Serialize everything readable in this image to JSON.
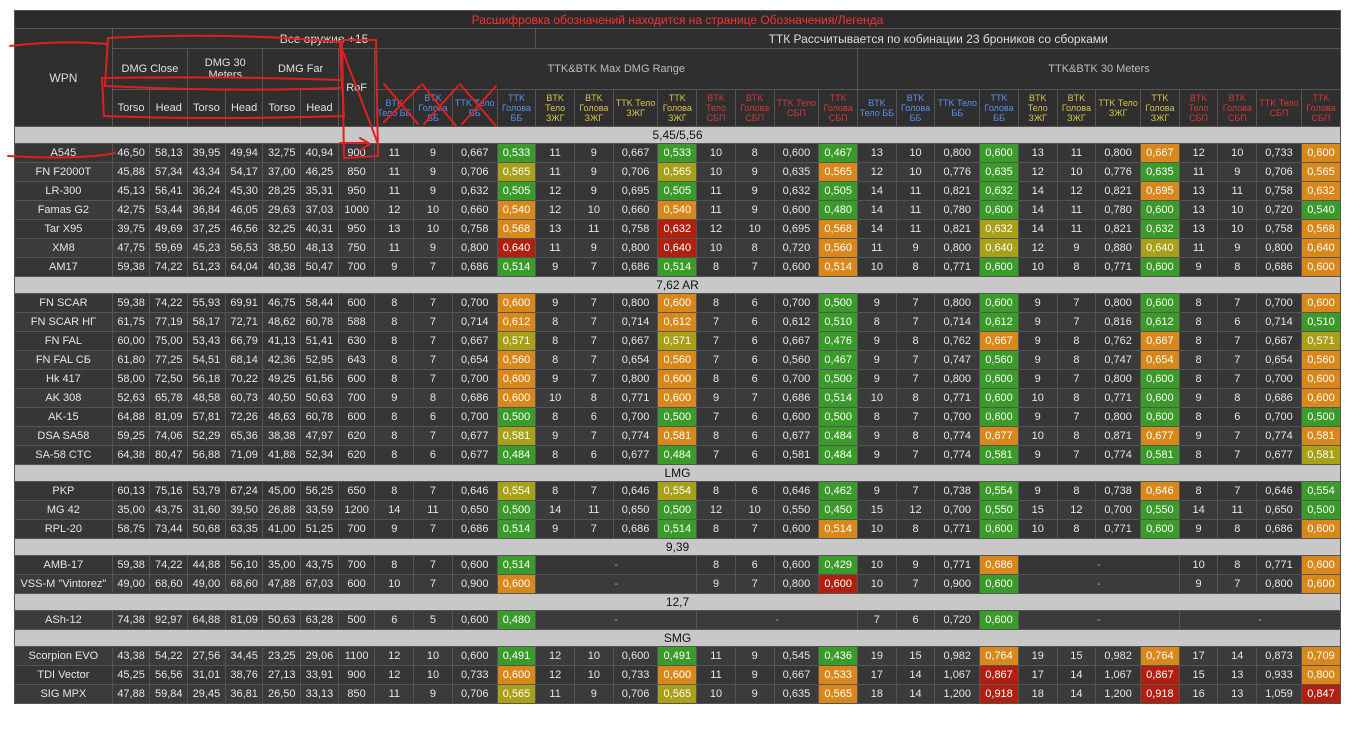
{
  "banner": "Расшифровка обозначений находится на странице Обозначения/Легенда",
  "groups": {
    "all_weapons": "Все оружие +15",
    "ttk_note": "ТТК Рассчитывается по кобинации 23 броников со сборками"
  },
  "headers": {
    "wpn": "WPN",
    "dmg_close": "DMG Close",
    "dmg_30": "DMG 30 Meters",
    "dmg_far": "DMG Far",
    "rof": "RoF",
    "ttk_range": "TTK&BTK Max DMG Range",
    "ttk_30": "TTK&BTK 30 Meters",
    "torso": "Torso",
    "head": "Head"
  },
  "sub_cols": [
    {
      "t": "BTK Тело ББ",
      "c": "blue"
    },
    {
      "t": "BTK Голова ББ",
      "c": "blue"
    },
    {
      "t": "TTK Тело ББ",
      "c": "blue"
    },
    {
      "t": "TTK Голова ББ",
      "c": "blue"
    },
    {
      "t": "BTK Тело ЗЖГ",
      "c": "yel"
    },
    {
      "t": "BTK Голова ЗЖГ",
      "c": "yel"
    },
    {
      "t": "TTK Тело ЗЖГ",
      "c": "yel"
    },
    {
      "t": "TTK Голова ЗЖГ",
      "c": "yel"
    },
    {
      "t": "BTK Тело СБП",
      "c": "red"
    },
    {
      "t": "BTK Голова СБП",
      "c": "red"
    },
    {
      "t": "TTK Тело СБП",
      "c": "red"
    },
    {
      "t": "TTK Голова СБП",
      "c": "red"
    },
    {
      "t": "BTK Тело ББ",
      "c": "blue"
    },
    {
      "t": "BTK Голова ББ",
      "c": "blue"
    },
    {
      "t": "TTK Тело ББ",
      "c": "blue"
    },
    {
      "t": "TTK Голова ББ",
      "c": "blue"
    },
    {
      "t": "BTK Тело ЗЖГ",
      "c": "yel"
    },
    {
      "t": "BTK Голова ЗЖГ",
      "c": "yel"
    },
    {
      "t": "TTK Тело ЗЖГ",
      "c": "yel"
    },
    {
      "t": "TTK Голова ЗЖГ",
      "c": "yel"
    },
    {
      "t": "BTK Тело СБП",
      "c": "red"
    },
    {
      "t": "BTK Голова СБП",
      "c": "red"
    },
    {
      "t": "TTK Тело СБП",
      "c": "red"
    },
    {
      "t": "TTK Голова СБП",
      "c": "red"
    }
  ],
  "sections": [
    {
      "name": "5,45/5,56",
      "rows": [
        [
          "A545",
          "46,50",
          "58,13",
          "39,95",
          "49,94",
          "32,75",
          "40,94",
          "900",
          "11",
          "9",
          "0,667",
          "0,533:g",
          "11",
          "9",
          "0,667",
          "0,533:g",
          "10",
          "8",
          "0,600",
          "0,467:g",
          "13",
          "10",
          "0,800",
          "0,600:g",
          "13",
          "11",
          "0,800",
          "0,667:o",
          "12",
          "10",
          "0,733",
          "0,600:o"
        ],
        [
          "FN F2000T",
          "45,88",
          "57,34",
          "43,34",
          "54,17",
          "37,00",
          "46,25",
          "850",
          "11",
          "9",
          "0,706",
          "0,565:y",
          "11",
          "9",
          "0,706",
          "0,565:y",
          "10",
          "9",
          "0,635",
          "0,565:o",
          "12",
          "10",
          "0,776",
          "0,635:g",
          "12",
          "10",
          "0,776",
          "0,635:g",
          "11",
          "9",
          "0,706",
          "0,565:o"
        ],
        [
          "LR-300",
          "45,13",
          "56,41",
          "36,24",
          "45,30",
          "28,25",
          "35,31",
          "950",
          "11",
          "9",
          "0,632",
          "0,505:g",
          "12",
          "9",
          "0,695",
          "0,505:g",
          "11",
          "9",
          "0,632",
          "0,505:g",
          "14",
          "11",
          "0,821",
          "0,632:g",
          "14",
          "12",
          "0,821",
          "0,695:o",
          "13",
          "11",
          "0,758",
          "0,632:o"
        ],
        [
          "Famas G2",
          "42,75",
          "53,44",
          "36,84",
          "46,05",
          "29,63",
          "37,03",
          "1000",
          "12",
          "10",
          "0,660",
          "0,540:o",
          "12",
          "10",
          "0,660",
          "0,540:o",
          "11",
          "9",
          "0,600",
          "0,480:g",
          "14",
          "11",
          "0,780",
          "0,600:g",
          "14",
          "11",
          "0,780",
          "0,600:g",
          "13",
          "10",
          "0,720",
          "0,540:g"
        ],
        [
          "Tar X95",
          "39,75",
          "49,69",
          "37,25",
          "46,56",
          "32,25",
          "40,31",
          "950",
          "13",
          "10",
          "0,758",
          "0,568:o",
          "13",
          "11",
          "0,758",
          "0,632:r",
          "12",
          "10",
          "0,695",
          "0,568:o",
          "14",
          "11",
          "0,821",
          "0,632:y",
          "14",
          "11",
          "0,821",
          "0,632:g",
          "13",
          "10",
          "0,758",
          "0,568:o"
        ],
        [
          "XM8",
          "47,75",
          "59,69",
          "45,23",
          "56,53",
          "38,50",
          "48,13",
          "750",
          "11",
          "9",
          "0,800",
          "0,640:r",
          "11",
          "9",
          "0,800",
          "0,640:r",
          "10",
          "8",
          "0,720",
          "0,560:o",
          "11",
          "9",
          "0,800",
          "0,640:y",
          "12",
          "9",
          "0,880",
          "0,640:y",
          "11",
          "9",
          "0,800",
          "0,640:o"
        ],
        [
          "AM17",
          "59,38",
          "74,22",
          "51,23",
          "64,04",
          "40,38",
          "50,47",
          "700",
          "9",
          "7",
          "0,686",
          "0,514:g",
          "9",
          "7",
          "0,686",
          "0,514:g",
          "8",
          "7",
          "0,600",
          "0,514:o",
          "10",
          "8",
          "0,771",
          "0,600:g",
          "10",
          "8",
          "0,771",
          "0,600:g",
          "9",
          "8",
          "0,686",
          "0,600:o"
        ]
      ]
    },
    {
      "name": "7,62 AR",
      "rows": [
        [
          "FN SCAR",
          "59,38",
          "74,22",
          "55,93",
          "69,91",
          "46,75",
          "58,44",
          "600",
          "8",
          "7",
          "0,700",
          "0,600:o",
          "9",
          "7",
          "0,800",
          "0,600:o",
          "8",
          "6",
          "0,700",
          "0,500:g",
          "9",
          "7",
          "0,800",
          "0,600:g",
          "9",
          "7",
          "0,800",
          "0,600:g",
          "8",
          "7",
          "0,700",
          "0,600:o"
        ],
        [
          "FN SCAR НГ",
          "61,75",
          "77,19",
          "58,17",
          "72,71",
          "48,62",
          "60,78",
          "588",
          "8",
          "7",
          "0,714",
          "0,612:o",
          "8",
          "7",
          "0,714",
          "0,612:o",
          "7",
          "6",
          "0,612",
          "0,510:g",
          "8",
          "7",
          "0,714",
          "0,612:g",
          "9",
          "7",
          "0,816",
          "0,612:g",
          "8",
          "6",
          "0,714",
          "0,510:g"
        ],
        [
          "FN FAL",
          "60,00",
          "75,00",
          "53,43",
          "66,79",
          "41,13",
          "51,41",
          "630",
          "8",
          "7",
          "0,667",
          "0,571:y",
          "8",
          "7",
          "0,667",
          "0,571:y",
          "7",
          "6",
          "0,667",
          "0,476:g",
          "9",
          "8",
          "0,762",
          "0,667:o",
          "9",
          "8",
          "0,762",
          "0,667:o",
          "8",
          "7",
          "0,667",
          "0,571:y"
        ],
        [
          "FN FAL СБ",
          "61,80",
          "77,25",
          "54,51",
          "68,14",
          "42,36",
          "52,95",
          "643",
          "8",
          "7",
          "0,654",
          "0,560:o",
          "8",
          "7",
          "0,654",
          "0,560:o",
          "7",
          "6",
          "0,560",
          "0,467:g",
          "9",
          "7",
          "0,747",
          "0,560:g",
          "9",
          "8",
          "0,747",
          "0,654:o",
          "8",
          "7",
          "0,654",
          "0,560:o"
        ],
        [
          "Hk 417",
          "58,00",
          "72,50",
          "56,18",
          "70,22",
          "49,25",
          "61,56",
          "600",
          "8",
          "7",
          "0,700",
          "0,600:o",
          "9",
          "7",
          "0,800",
          "0,600:o",
          "8",
          "6",
          "0,700",
          "0,500:g",
          "9",
          "7",
          "0,800",
          "0,600:g",
          "9",
          "7",
          "0,800",
          "0,600:g",
          "8",
          "7",
          "0,700",
          "0,600:o"
        ],
        [
          "AK 308",
          "52,63",
          "65,78",
          "48,58",
          "60,73",
          "40,50",
          "50,63",
          "700",
          "9",
          "8",
          "0,686",
          "0,600:o",
          "10",
          "8",
          "0,771",
          "0,600:o",
          "9",
          "7",
          "0,686",
          "0,514:g",
          "10",
          "8",
          "0,771",
          "0,600:g",
          "10",
          "8",
          "0,771",
          "0,600:g",
          "9",
          "8",
          "0,686",
          "0,600:o"
        ],
        [
          "AK-15",
          "64,88",
          "81,09",
          "57,81",
          "72,26",
          "48,63",
          "60,78",
          "600",
          "8",
          "6",
          "0,700",
          "0,500:g",
          "8",
          "6",
          "0,700",
          "0,500:g",
          "7",
          "6",
          "0,600",
          "0,500:g",
          "8",
          "7",
          "0,700",
          "0,600:g",
          "9",
          "7",
          "0,800",
          "0,600:g",
          "8",
          "6",
          "0,700",
          "0,500:g"
        ],
        [
          "DSA SA58",
          "59,25",
          "74,06",
          "52,29",
          "65,36",
          "38,38",
          "47,97",
          "620",
          "8",
          "7",
          "0,677",
          "0,581:y",
          "9",
          "7",
          "0,774",
          "0,581:o",
          "8",
          "6",
          "0,677",
          "0,484:g",
          "9",
          "8",
          "0,774",
          "0,677:o",
          "10",
          "8",
          "0,871",
          "0,677:o",
          "9",
          "7",
          "0,774",
          "0,581:o"
        ],
        [
          "SA-58 CTC",
          "64,38",
          "80,47",
          "56,88",
          "71,09",
          "41,88",
          "52,34",
          "620",
          "8",
          "6",
          "0,677",
          "0,484:g",
          "8",
          "6",
          "0,677",
          "0,484:g",
          "7",
          "6",
          "0,581",
          "0,484:g",
          "9",
          "7",
          "0,774",
          "0,581:g",
          "9",
          "7",
          "0,774",
          "0,581:g",
          "8",
          "7",
          "0,677",
          "0,581:y"
        ]
      ]
    },
    {
      "name": "LMG",
      "rows": [
        [
          "PKP",
          "60,13",
          "75,16",
          "53,79",
          "67,24",
          "45,00",
          "56,25",
          "650",
          "8",
          "7",
          "0,646",
          "0,554:y",
          "8",
          "7",
          "0,646",
          "0,554:y",
          "8",
          "6",
          "0,646",
          "0,462:g",
          "9",
          "7",
          "0,738",
          "0,554:g",
          "9",
          "8",
          "0,738",
          "0,646:o",
          "8",
          "7",
          "0,646",
          "0,554:g"
        ],
        [
          "MG 42",
          "35,00",
          "43,75",
          "31,60",
          "39,50",
          "26,88",
          "33,59",
          "1200",
          "14",
          "11",
          "0,650",
          "0,500:g",
          "14",
          "11",
          "0,650",
          "0,500:g",
          "12",
          "10",
          "0,550",
          "0,450:g",
          "15",
          "12",
          "0,700",
          "0,550:g",
          "15",
          "12",
          "0,700",
          "0,550:g",
          "14",
          "11",
          "0,650",
          "0,500:g"
        ],
        [
          "RPL-20",
          "58,75",
          "73,44",
          "50,68",
          "63,35",
          "41,00",
          "51,25",
          "700",
          "9",
          "7",
          "0,686",
          "0,514:g",
          "9",
          "7",
          "0,686",
          "0,514:g",
          "8",
          "7",
          "0,600",
          "0,514:o",
          "10",
          "8",
          "0,771",
          "0,600:g",
          "10",
          "8",
          "0,771",
          "0,600:g",
          "9",
          "8",
          "0,686",
          "0,600:o"
        ]
      ]
    },
    {
      "name": "9,39",
      "rows": [
        [
          "AMB-17",
          "59,38",
          "74,22",
          "44,88",
          "56,10",
          "35,00",
          "43,75",
          "700",
          "8",
          "7",
          "0,600",
          "0,514:g",
          "-4",
          "",
          "",
          "",
          "8",
          "6",
          "0,600",
          "0,429:g",
          "10",
          "9",
          "0,771",
          "0,686:o",
          "-4",
          "",
          "",
          "",
          "10",
          "8",
          "0,771",
          "0,600:o"
        ],
        [
          "VSS-M \"Vintorez\"",
          "49,00",
          "68,60",
          "49,00",
          "68,60",
          "47,88",
          "67,03",
          "600",
          "10",
          "7",
          "0,900",
          "0,600:o",
          "-4",
          "",
          "",
          "",
          "9",
          "7",
          "0,800",
          "0,600:r",
          "10",
          "7",
          "0,900",
          "0,600:g",
          "-4",
          "",
          "",
          "",
          "9",
          "7",
          "0,800",
          "0,600:o"
        ]
      ]
    },
    {
      "name": "12,7",
      "rows": [
        [
          "ASh-12",
          "74,38",
          "92,97",
          "64,88",
          "81,09",
          "50,63",
          "63,28",
          "500",
          "6",
          "5",
          "0,600",
          "0,480:g",
          "-4",
          "",
          "",
          "",
          "-4",
          "",
          "",
          "",
          "7",
          "6",
          "0,720",
          "0,600:g",
          "-4",
          "",
          "",
          "",
          "-4",
          "",
          "",
          ""
        ]
      ]
    },
    {
      "name": "SMG",
      "rows": [
        [
          "Scorpion EVO",
          "43,38",
          "54,22",
          "27,56",
          "34,45",
          "23,25",
          "29,06",
          "1100",
          "12",
          "10",
          "0,600",
          "0,491:g",
          "12",
          "10",
          "0,600",
          "0,491:g",
          "11",
          "9",
          "0,545",
          "0,436:g",
          "19",
          "15",
          "0,982",
          "0,764:o",
          "19",
          "15",
          "0,982",
          "0,764:o",
          "17",
          "14",
          "0,873",
          "0,709:o"
        ],
        [
          "TDI Vector",
          "45,25",
          "56,56",
          "31,01",
          "38,76",
          "27,13",
          "33,91",
          "900",
          "12",
          "10",
          "0,733",
          "0,600:o",
          "12",
          "10",
          "0,733",
          "0,600:o",
          "11",
          "9",
          "0,667",
          "0,533:o",
          "17",
          "14",
          "1,067",
          "0,867:r",
          "17",
          "14",
          "1,067",
          "0,867:r",
          "15",
          "13",
          "0,933",
          "0,800:o"
        ],
        [
          "SIG MPX",
          "47,88",
          "59,84",
          "29,45",
          "36,81",
          "26,50",
          "33,13",
          "850",
          "11",
          "9",
          "0,706",
          "0,565:y",
          "11",
          "9",
          "0,706",
          "0,565:y",
          "10",
          "9",
          "0,635",
          "0,565:o",
          "18",
          "14",
          "1,200",
          "0,918:r",
          "18",
          "14",
          "1,200",
          "0,918:r",
          "16",
          "13",
          "1,059",
          "0,847:r"
        ]
      ]
    }
  ]
}
